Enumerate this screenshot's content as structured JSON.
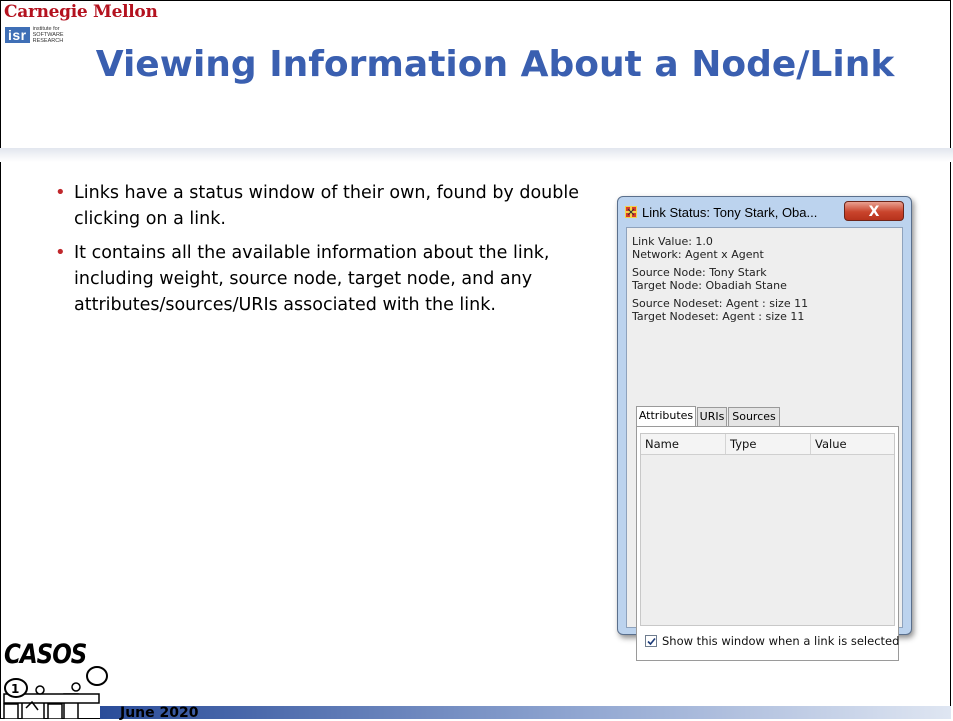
{
  "header": {
    "org": "Carnegie Mellon",
    "institute_abbr": "isr",
    "institute_full": "institute for SOFTWARE RESEARCH"
  },
  "slide": {
    "title": "Viewing Information About a Node/Link",
    "bullets": [
      "Links have a status window of their own, found by double clicking on a link.",
      "It contains all the available information about the link, including weight, source node, target node, and any attributes/sources/URIs associated with the link."
    ]
  },
  "dialog": {
    "title": "Link Status: Tony Stark, Oba...",
    "close_label": "X",
    "info_lines": [
      "Link Value: 1.0",
      "Network: Agent x Agent",
      "Source Node: Tony Stark",
      "Target Node: Obadiah Stane",
      "Source Nodeset: Agent : size 11",
      "Target Nodeset: Agent : size 11"
    ],
    "tabs": [
      "Attributes",
      "URIs",
      "Sources"
    ],
    "active_tab": "Attributes",
    "columns": [
      "Name",
      "Type",
      "Value"
    ],
    "checkbox_label": "Show this window when a link is selected",
    "checkbox_checked": true
  },
  "footer": {
    "date": "June 2020",
    "logo_text": "CASOS"
  },
  "colors": {
    "title": "#3a5fb0",
    "bullet": "#c0282c",
    "cmu_red": "#b4121f",
    "dialog_frame": "#bcd3ee",
    "close_button": "#c9442c"
  }
}
